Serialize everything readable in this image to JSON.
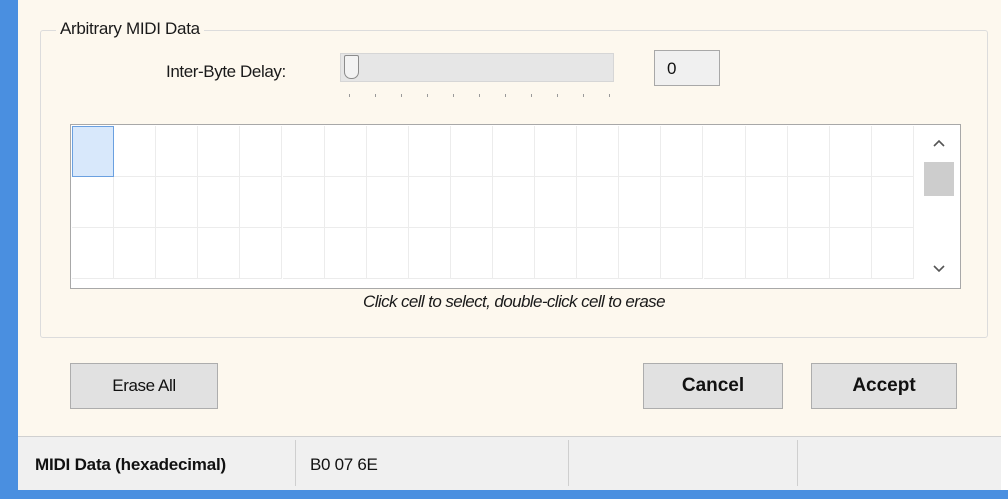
{
  "group": {
    "title": "Arbitrary MIDI Data"
  },
  "delay": {
    "label": "Inter-Byte Delay:",
    "value": "0",
    "slider_level": 0
  },
  "grid": {
    "selected_index": 0,
    "hint": "Click cell to select, double-click cell to erase"
  },
  "buttons": {
    "erase_all": "Erase All",
    "cancel": "Cancel",
    "accept": "Accept"
  },
  "status": {
    "label": "MIDI Data (hexadecimal)",
    "value": "B0 07 6E"
  },
  "icons": {
    "scroll_up": "chevron-up-icon",
    "scroll_down": "chevron-down-icon"
  },
  "colors": {
    "frame_accent": "#4a8fe0",
    "window_background": "#fdf8ee",
    "selected_cell": "#d8e8fb"
  }
}
